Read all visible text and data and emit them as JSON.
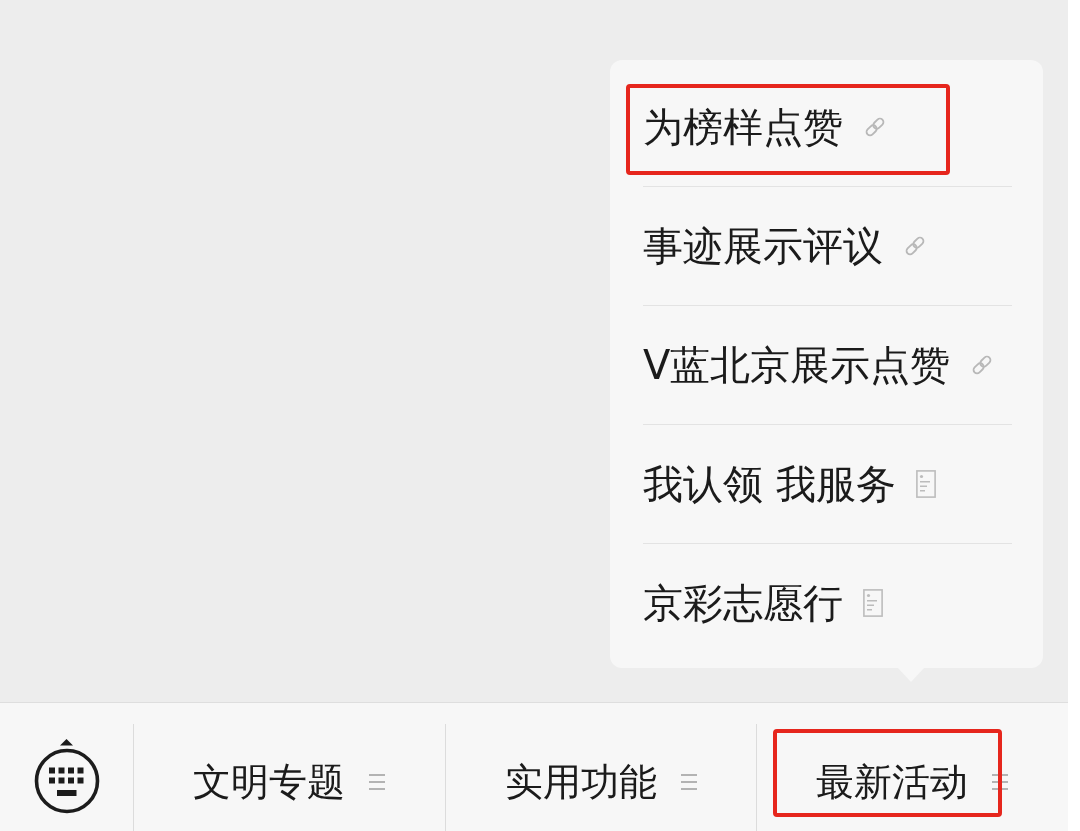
{
  "menu_bar": {
    "tabs": [
      {
        "label": "文明专题",
        "highlighted": false
      },
      {
        "label": "实用功能",
        "highlighted": false
      },
      {
        "label": "最新活动",
        "highlighted": true,
        "submenu": [
          {
            "label": "为榜样点赞",
            "kind": "link",
            "highlighted": true
          },
          {
            "label": "事迹展示评议",
            "kind": "link",
            "highlighted": false
          },
          {
            "label": "V蓝北京展示点赞",
            "kind": "link",
            "highlighted": false
          },
          {
            "label": "我认领 我服务",
            "kind": "article",
            "highlighted": false
          },
          {
            "label": "京彩志愿行",
            "kind": "article",
            "highlighted": false
          }
        ]
      }
    ]
  }
}
